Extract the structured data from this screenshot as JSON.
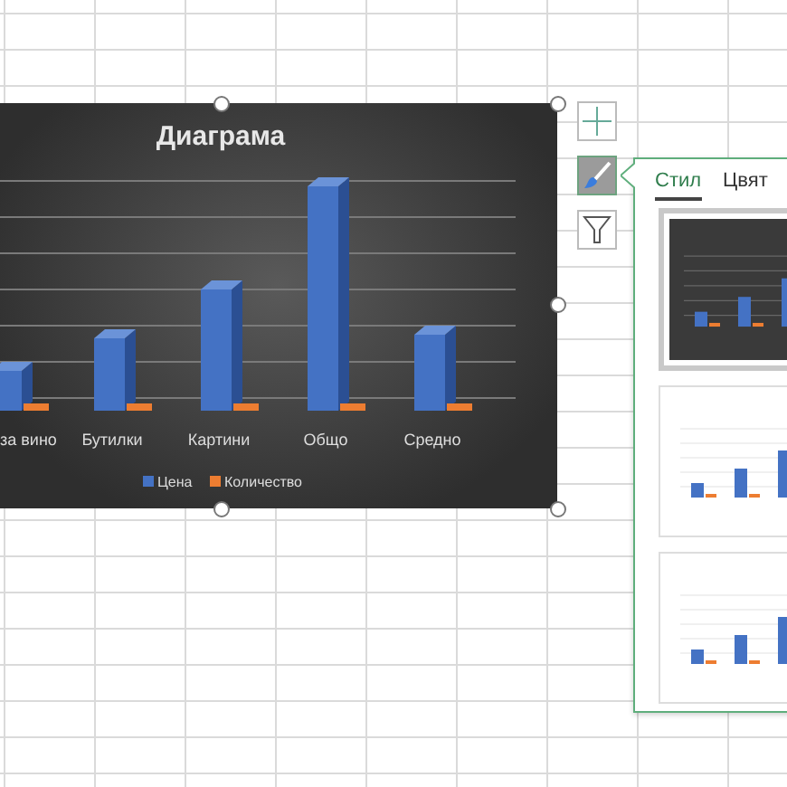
{
  "chart": {
    "title": "Диаграма",
    "categories": [
      "за вино",
      "Бутилки",
      "Картини",
      "Общо",
      "Средно"
    ],
    "legend": [
      {
        "label": "Цена",
        "color": "#4472c4"
      },
      {
        "label": "Количество",
        "color": "#ed7d31"
      }
    ]
  },
  "chart_tools": [
    {
      "kind": "add",
      "selected": false
    },
    {
      "kind": "brush",
      "selected": true
    },
    {
      "kind": "filter",
      "selected": false
    }
  ],
  "style_panel": {
    "tabs": [
      {
        "label": "Стил",
        "selected": true
      },
      {
        "label": "Цвят",
        "selected": false
      }
    ],
    "styles": [
      {
        "kind": "dark",
        "selected": true
      },
      {
        "kind": "light",
        "selected": false
      },
      {
        "kind": "light",
        "selected": false
      }
    ]
  }
}
